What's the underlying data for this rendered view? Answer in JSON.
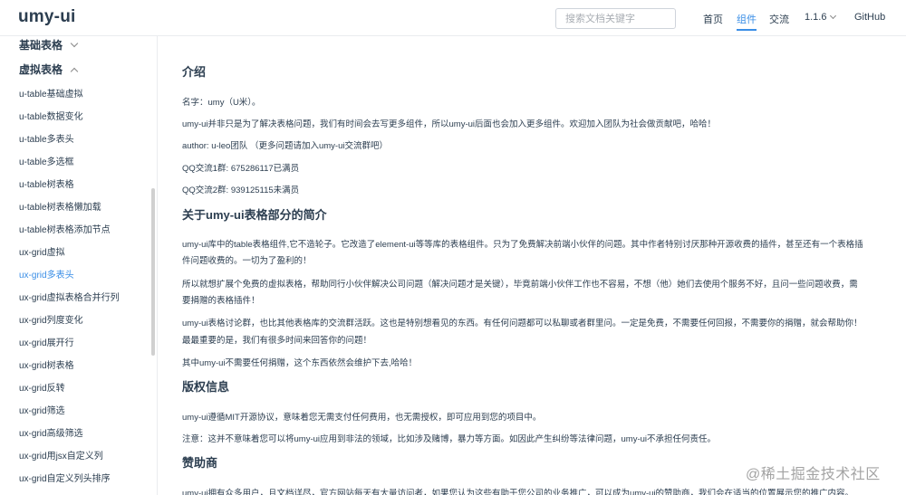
{
  "navbar": {
    "logo": "umy-ui",
    "search_placeholder": "搜索文档关键字",
    "items": {
      "home": "首页",
      "components": "组件",
      "community": "交流",
      "version": "1.1.6",
      "github": "GitHub"
    }
  },
  "sidebar": {
    "group_basic": "基础表格",
    "group_virtual": "虚拟表格",
    "items": [
      "u-table基础虚拟",
      "u-table数据变化",
      "u-table多表头",
      "u-table多选框",
      "u-table树表格",
      "u-table树表格懒加载",
      "u-table树表格添加节点",
      "ux-grid虚拟",
      "ux-grid多表头",
      "ux-grid虚拟表格合并行列",
      "ux-grid列度变化",
      "ux-grid展开行",
      "ux-grid树表格",
      "ux-grid反转",
      "ux-grid筛选",
      "ux-grid高级筛选",
      "ux-grid用jsx自定义列",
      "ux-grid自定义列头排序"
    ],
    "active_item": "ux-grid多表头"
  },
  "content": {
    "intro_title": "介绍",
    "intro_lines": [
      "名字：umy（U米）。",
      "umy-ui并非只是为了解决表格问题，我们有时间会去写更多组件，所以umy-ui后面也会加入更多组件。欢迎加入团队为社会做贡献吧，哈哈！",
      "author: u-leo团队 （更多问题请加入umy-ui交流群吧）",
      "QQ交流1群: 675286117已满员",
      "QQ交流2群: 939125115未满员"
    ],
    "about_title": "关于umy-ui表格部分的简介",
    "about_lines": [
      "umy-ui库中的table表格组件,它不造轮子。它改造了element-ui等等库的表格组件。只为了免费解决前端小伙伴的问题。其中作者特别讨厌那种开源收费的插件，甚至还有一个表格插",
      "件问题收费的。一切为了盈利的！",
      "所以就想扩展个免费的虚拟表格，帮助同行小伙伴解决公司问题（解决问题才是关键），毕竟前端小伙伴工作也不容易，不想（他）她们去使用个服务不好，且问一些问题收费，需",
      "要捐赠的表格插件！",
      "umy-ui表格讨论群，也比其他表格库的交流群活跃。这也是特别想看见的东西。有任何问题都可以私聊或者群里问。一定是免费，不需要任何回报，不需要你的捐赠，就会帮助你！",
      "最最重要的是，我们有很多时间来回答你的问题！",
      "其中umy-ui不需要任何捐赠，这个东西依然会维护下去,哈哈！"
    ],
    "copyright_title": "版权信息",
    "copyright_lines": [
      "umy-ui遵循MIT开源协议，意味着您无需支付任何费用，也无需授权，即可应用到您的项目中。",
      "注意：这并不意味着您可以将umy-ui应用到非法的领域，比如涉及赌博，暴力等方面。如因此产生纠纷等法律问题，umy-ui不承担任何责任。"
    ],
    "sponsor_title": "赞助商",
    "sponsor_lines": [
      "umy-ui拥有众多用户，且文档详尽，官方网站每天有大量访问者，如果您认为这些有助于您公司的业务推广，可以成为umy-ui的赞助商，我们会在适当的位置展示您的推广内容。"
    ]
  },
  "watermark": "@稀土掘金技术社区",
  "colors": {
    "accent": "#3a8ee6",
    "text": "#2c3e50",
    "border": "#eaecef"
  }
}
